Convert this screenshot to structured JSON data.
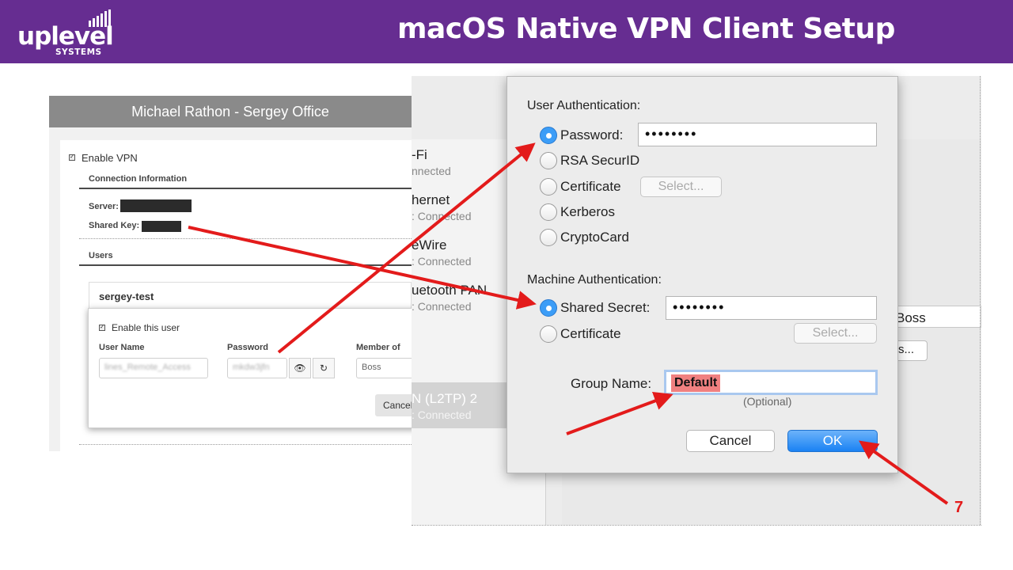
{
  "header": {
    "title": "macOS Native VPN Client Setup",
    "logo_word": "uplevel",
    "logo_sub": "SYSTEMS",
    "bg_color": "#662d91"
  },
  "portal": {
    "title": "Michael Rathon - Sergey Office",
    "enable_vpn_label": "Enable VPN",
    "connection_info_heading": "Connection Information",
    "server_label": "Server:",
    "shared_key_label": "Shared Key:",
    "users_heading": "Users",
    "username": "sergey-test",
    "enable_user_label": "Enable this user",
    "col_user_name": "User Name",
    "col_password": "Password",
    "col_member_of": "Member of",
    "member_of_value": "Boss",
    "cancel_label": "Cancel"
  },
  "network": {
    "interfaces": [
      {
        "name": "-Fi",
        "status": "nnected"
      },
      {
        "name": "hernet",
        "status": ": Connected"
      },
      {
        "name": "eWire",
        "status": ": Connected"
      },
      {
        "name": "uetooth PAN",
        "status": ": Connected"
      },
      {
        "name": "N (L2TP) 2",
        "status": ": Connected"
      }
    ],
    "right_value": "Boss",
    "ellipsis_button": "s..."
  },
  "dialog": {
    "user_auth_heading": "User Authentication:",
    "user_auth_options": [
      "Password:",
      "RSA SecurID",
      "Certificate",
      "Kerberos",
      "CryptoCard"
    ],
    "password_value": "••••••••",
    "select_label": "Select...",
    "machine_auth_heading": "Machine Authentication:",
    "shared_secret_label": "Shared Secret:",
    "shared_secret_value": "••••••••",
    "machine_certificate_label": "Certificate",
    "group_name_label": "Group Name:",
    "group_name_value": "Default",
    "optional_label": "(Optional)",
    "cancel_label": "Cancel",
    "ok_label": "OK"
  },
  "annotation": {
    "step_number": "7",
    "arrow_color": "#e31b1b"
  }
}
